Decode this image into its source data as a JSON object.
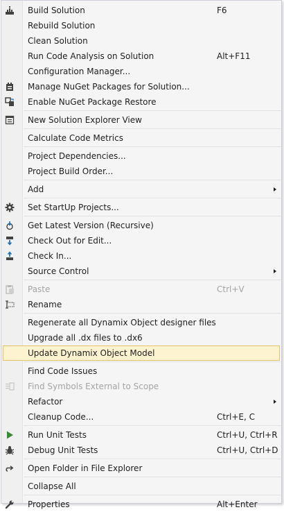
{
  "menu": {
    "items": [
      {
        "label": "Build Solution",
        "shortcut": "F6",
        "icon": "build-solution-icon"
      },
      {
        "label": "Rebuild Solution"
      },
      {
        "label": "Clean Solution"
      },
      {
        "label": "Run Code Analysis on Solution",
        "shortcut": "Alt+F11"
      },
      {
        "label": "Configuration Manager..."
      },
      {
        "label": "Manage NuGet Packages for Solution...",
        "icon": "nuget-icon"
      },
      {
        "label": "Enable NuGet Package Restore",
        "icon": "package-restore-icon"
      },
      {
        "label": "New Solution Explorer View",
        "icon": "solution-explorer-icon"
      },
      {
        "label": "Calculate Code Metrics"
      },
      {
        "label": "Project Dependencies..."
      },
      {
        "label": "Project Build Order..."
      },
      {
        "label": "Add",
        "submenu": true
      },
      {
        "label": "Set StartUp Projects...",
        "icon": "gear-icon"
      },
      {
        "label": "Get Latest Version (Recursive)",
        "icon": "get-latest-icon"
      },
      {
        "label": "Check Out for Edit...",
        "icon": "check-out-icon"
      },
      {
        "label": "Check In...",
        "icon": "check-in-icon"
      },
      {
        "label": "Source Control",
        "submenu": true
      },
      {
        "label": "Paste",
        "shortcut": "Ctrl+V",
        "icon": "paste-icon",
        "disabled": true
      },
      {
        "label": "Rename",
        "icon": "rename-icon"
      },
      {
        "label": "Regenerate all Dynamix Object designer files"
      },
      {
        "label": "Upgrade all .dx files to .dx6"
      },
      {
        "label": "Update Dynamix Object Model",
        "highlighted": true
      },
      {
        "label": "Find Code Issues"
      },
      {
        "label": "Find Symbols External to Scope",
        "icon": "find-symbols-icon",
        "disabled": true
      },
      {
        "label": "Refactor",
        "submenu": true
      },
      {
        "label": "Cleanup Code...",
        "shortcut": "Ctrl+E, C"
      },
      {
        "label": "Run Unit Tests",
        "shortcut": "Ctrl+U, Ctrl+R",
        "icon": "run-tests-icon"
      },
      {
        "label": "Debug Unit Tests",
        "shortcut": "Ctrl+U, Ctrl+D",
        "icon": "debug-tests-icon"
      },
      {
        "label": "Open Folder in File Explorer",
        "icon": "open-folder-icon"
      },
      {
        "label": "Collapse All"
      },
      {
        "label": "Properties",
        "shortcut": "Alt+Enter",
        "icon": "properties-wrench-icon"
      }
    ]
  },
  "colors": {
    "menu_background": "#f5f5f5",
    "highlight_background": "#fdf3d1",
    "highlight_border": "#e5c365",
    "disabled_text": "#a2a4a5",
    "run_tests_green": "#388a34"
  }
}
